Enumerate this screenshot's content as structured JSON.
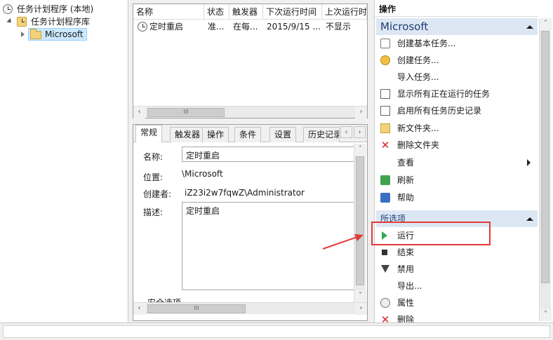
{
  "tree": {
    "root_label": "任务计划程序 (本地)",
    "library_label": "任务计划程序库",
    "folder_label": "Microsoft"
  },
  "task_list": {
    "columns": [
      "名称",
      "状态",
      "触发器",
      "下次运行时间",
      "上次运行时"
    ],
    "rows": [
      {
        "name": "定时重启",
        "status": "准...",
        "trigger": "在每...",
        "next_run": "2015/9/15 ...",
        "last_run": "不显示"
      }
    ],
    "scroll_thumb": "III"
  },
  "details": {
    "tabs": [
      "常规",
      "触发器",
      "操作",
      "条件",
      "设置",
      "历史记录"
    ],
    "active_tab": "常规",
    "name_label": "名称:",
    "name_value": "定时重启",
    "location_label": "位置:",
    "location_value": "\\Microsoft",
    "author_label": "创建者:",
    "author_value": "iZ23i2w7fqwZ\\Administrator",
    "desc_label": "描述:",
    "desc_value": "定时重启",
    "security_label": "安全选项",
    "scroll_thumb": "III"
  },
  "actions": {
    "header": "操作",
    "section1": "Microsoft",
    "section1_items": [
      {
        "label": "创建基本任务...",
        "icon": "basic-task-icon"
      },
      {
        "label": "创建任务...",
        "icon": "create-task-icon"
      },
      {
        "label": "导入任务...",
        "icon": ""
      },
      {
        "label": "显示所有正在运行的任务",
        "icon": "running-tasks-icon"
      },
      {
        "label": "启用所有任务历史记录",
        "icon": "history-icon"
      },
      {
        "label": "新文件夹...",
        "icon": "new-folder-icon"
      },
      {
        "label": "删除文件夹",
        "icon": "delete-icon"
      },
      {
        "label": "查看",
        "icon": ""
      },
      {
        "label": "刷新",
        "icon": "refresh-icon"
      },
      {
        "label": "帮助",
        "icon": "help-icon"
      }
    ],
    "section2": "所选项",
    "section2_items": [
      {
        "label": "运行",
        "icon": "run-icon"
      },
      {
        "label": "结束",
        "icon": "end-icon"
      },
      {
        "label": "禁用",
        "icon": "disable-icon"
      },
      {
        "label": "导出...",
        "icon": ""
      },
      {
        "label": "属性",
        "icon": "properties-icon"
      },
      {
        "label": "删除",
        "icon": "delete-icon"
      }
    ],
    "scroll_thumb": "III"
  },
  "colors": {
    "section_header_bg": "#dde7f4",
    "highlight": "#e23b3b",
    "run_green": "#2fa84f"
  }
}
